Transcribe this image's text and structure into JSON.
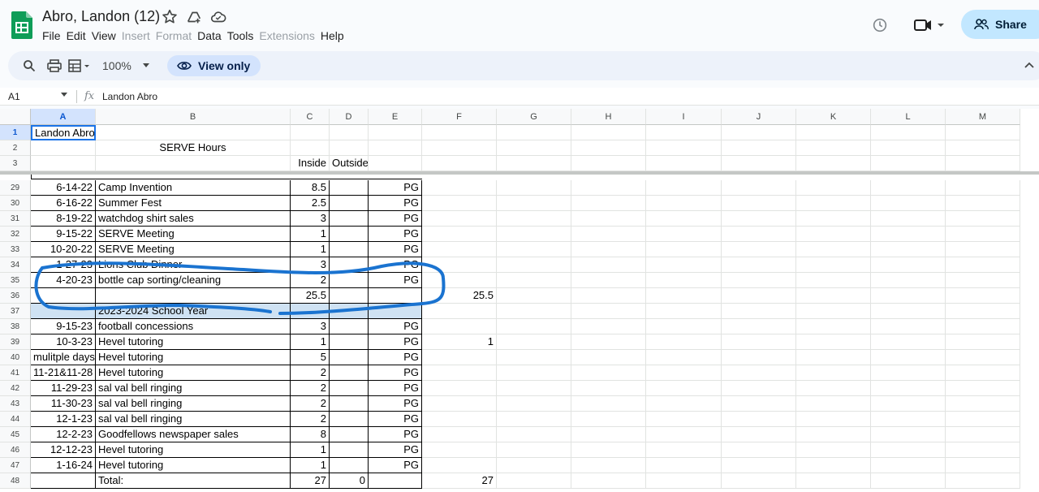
{
  "doc": {
    "title": "Abro, Landon (12)",
    "menu": [
      "File",
      "Edit",
      "View",
      "Insert",
      "Format",
      "Data",
      "Tools",
      "Extensions",
      "Help"
    ],
    "menu_disabled": [
      "Insert",
      "Format",
      "Extensions"
    ],
    "share_label": "Share"
  },
  "toolbar": {
    "zoom": "100%",
    "view_only_label": "View only"
  },
  "formula_bar": {
    "cell_ref": "A1",
    "fx": "fx",
    "value": "Landon Abro"
  },
  "columns": [
    "A",
    "B",
    "C",
    "D",
    "E",
    "F",
    "G",
    "H",
    "I",
    "J",
    "K",
    "L",
    "M"
  ],
  "frozen_rows": [
    {
      "num": "1",
      "A": "Landon Abro",
      "B": "",
      "C": "",
      "D": "",
      "E": "",
      "F": ""
    },
    {
      "num": "2",
      "A": "",
      "B": "SERVE Hours",
      "C": "",
      "D": "",
      "E": "",
      "F": ""
    },
    {
      "num": "3",
      "A": "",
      "B": "",
      "C": "Inside",
      "D": "Outside",
      "E": "",
      "F": ""
    }
  ],
  "rows": [
    {
      "num": "29",
      "A": "6-14-22",
      "B": "Camp Invention",
      "C": "8.5",
      "D": "",
      "E": "PG",
      "F": ""
    },
    {
      "num": "30",
      "A": "6-16-22",
      "B": "Summer Fest",
      "C": "2.5",
      "D": "",
      "E": "PG",
      "F": ""
    },
    {
      "num": "31",
      "A": "8-19-22",
      "B": "watchdog shirt sales",
      "C": "3",
      "D": "",
      "E": "PG",
      "F": ""
    },
    {
      "num": "32",
      "A": "9-15-22",
      "B": "SERVE Meeting",
      "C": "1",
      "D": "",
      "E": "PG",
      "F": ""
    },
    {
      "num": "33",
      "A": "10-20-22",
      "B": "SERVE Meeting",
      "C": "1",
      "D": "",
      "E": "PG",
      "F": ""
    },
    {
      "num": "34",
      "A": "1-27-23",
      "B": "Lions Club Dinner",
      "C": "3",
      "D": "",
      "E": "PG",
      "F": ""
    },
    {
      "num": "35",
      "A": "4-20-23",
      "B": "bottle cap sorting/cleaning",
      "C": "2",
      "D": "",
      "E": "PG",
      "F": ""
    },
    {
      "num": "36",
      "A": "",
      "B": "",
      "C": "25.5",
      "D": "",
      "E": "",
      "F": "25.5"
    },
    {
      "num": "37",
      "A": "",
      "B": "2023-2024 School Year",
      "C": "",
      "D": "",
      "E": "",
      "F": ""
    },
    {
      "num": "38",
      "A": "9-15-23",
      "B": "football concessions",
      "C": "3",
      "D": "",
      "E": "PG",
      "F": ""
    },
    {
      "num": "39",
      "A": "10-3-23",
      "B": "Hevel tutoring",
      "C": "1",
      "D": "",
      "E": "PG",
      "F": "1"
    },
    {
      "num": "40",
      "A": "mulitple days",
      "B": "Hevel tutoring",
      "C": "5",
      "D": "",
      "E": "PG",
      "F": ""
    },
    {
      "num": "41",
      "A": "11-21&11-28",
      "B": "Hevel tutoring",
      "C": "2",
      "D": "",
      "E": "PG",
      "F": ""
    },
    {
      "num": "42",
      "A": "11-29-23",
      "B": "sal val bell ringing",
      "C": "2",
      "D": "",
      "E": "PG",
      "F": ""
    },
    {
      "num": "43",
      "A": "11-30-23",
      "B": "sal val bell ringing",
      "C": "2",
      "D": "",
      "E": "PG",
      "F": ""
    },
    {
      "num": "44",
      "A": "12-1-23",
      "B": "sal val bell ringing",
      "C": "2",
      "D": "",
      "E": "PG",
      "F": ""
    },
    {
      "num": "45",
      "A": "12-2-23",
      "B": "Goodfellows newspaper sales",
      "C": "8",
      "D": "",
      "E": "PG",
      "F": ""
    },
    {
      "num": "46",
      "A": "12-12-23",
      "B": "Hevel tutoring",
      "C": "1",
      "D": "",
      "E": "PG",
      "F": ""
    },
    {
      "num": "47",
      "A": "1-16-24",
      "B": "Hevel tutoring",
      "C": "1",
      "D": "",
      "E": "PG",
      "F": ""
    },
    {
      "num": "48",
      "A": "",
      "B": "Total:",
      "C": "27",
      "D": "0",
      "E": "",
      "F": "27"
    }
  ],
  "colors": {
    "accent": "#1a73e8",
    "share_bg": "#c2e7ff",
    "highlight_row": "#cfe2f3",
    "annotation": "#1a73d0"
  }
}
